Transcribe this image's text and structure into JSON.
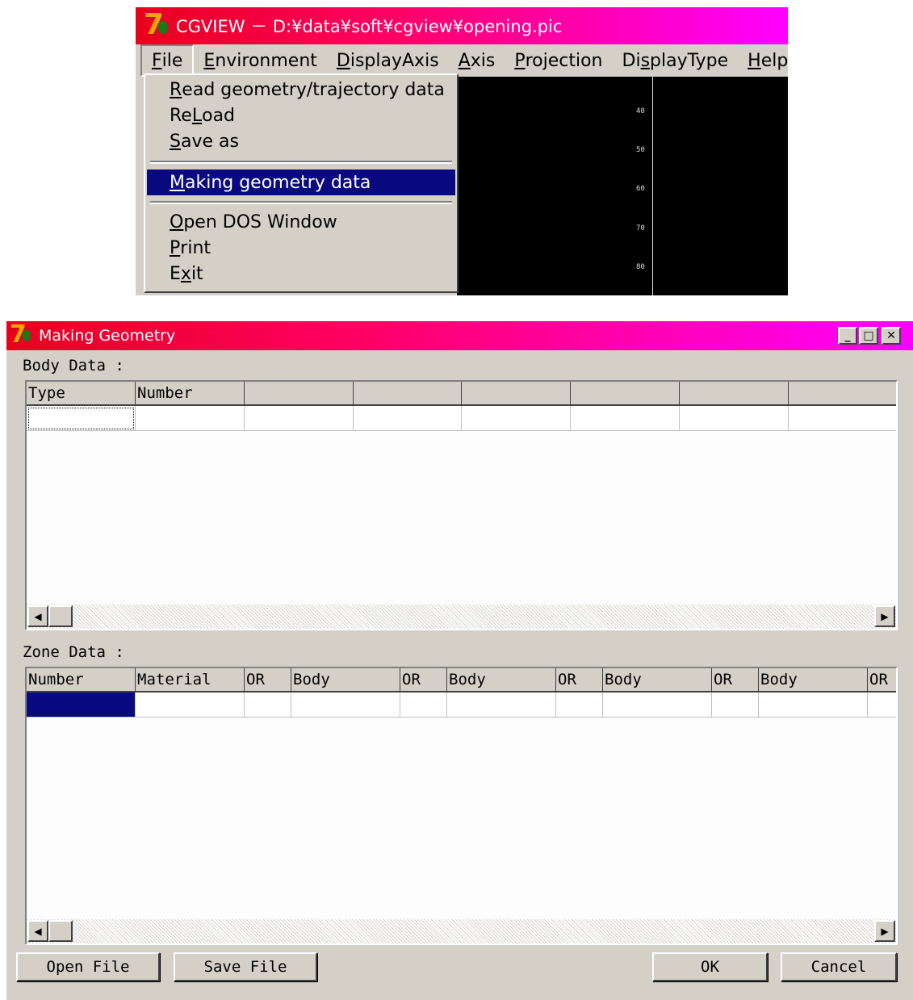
{
  "main_window": {
    "title": "CGVIEW － D:¥data¥soft¥cgview¥opening.pic",
    "menu": [
      {
        "label": "File",
        "hotkey": "F",
        "rest": "ile"
      },
      {
        "label": "Environment",
        "hotkey": "E",
        "rest": "nvironment"
      },
      {
        "label": "DisplayAxis",
        "hotkey": "D",
        "rest": "isplayAxis"
      },
      {
        "label": "Axis",
        "hotkey": "A",
        "rest": "xis"
      },
      {
        "label": "Projection",
        "hotkey": "P",
        "rest": "rojection"
      },
      {
        "label": "DisplayType",
        "pre": "Di",
        "hotkey": "s",
        "rest": "playType"
      },
      {
        "label": "Help",
        "hotkey": "H",
        "rest": "elp"
      }
    ],
    "file_menu": {
      "items": [
        {
          "pre": "",
          "hotkey": "R",
          "rest": "ead geometry/trajectory data"
        },
        {
          "pre": "Re",
          "hotkey": "L",
          "rest": "oad"
        },
        {
          "pre": "",
          "hotkey": "S",
          "rest": "ave as"
        },
        {
          "pre": "",
          "hotkey": "M",
          "rest": "aking geometry data"
        },
        {
          "pre": "",
          "hotkey": "O",
          "rest": "pen DOS Window"
        },
        {
          "pre": "",
          "hotkey": "P",
          "rest": "rint"
        },
        {
          "pre": "E",
          "hotkey": "x",
          "rest": "it"
        }
      ],
      "selected": "Making geometry data"
    },
    "axis_ticks": [
      "40",
      "50",
      "60",
      "70",
      "80"
    ]
  },
  "dialog": {
    "title": "Making Geometry",
    "title_buttons": [
      "minimize",
      "maximize",
      "close"
    ],
    "body_section_label": "Body Data :",
    "body_columns": [
      "Type",
      "Number",
      "",
      "",
      "",
      "",
      "",
      ""
    ],
    "zone_section_label": "Zone Data :",
    "zone_columns": [
      "Number",
      "Material",
      "OR",
      "Body",
      "OR",
      "Body",
      "OR",
      "Body",
      "OR",
      "Body",
      "OR"
    ],
    "buttons": {
      "open_file": "Open File",
      "save_file": "Save File",
      "ok": "OK",
      "cancel": "Cancel"
    }
  },
  "colors": {
    "title_gradient_start": "#e8001c",
    "title_gradient_end": "#ff00ff",
    "selection": "#0a0a80",
    "face": "#d4d0c8"
  }
}
